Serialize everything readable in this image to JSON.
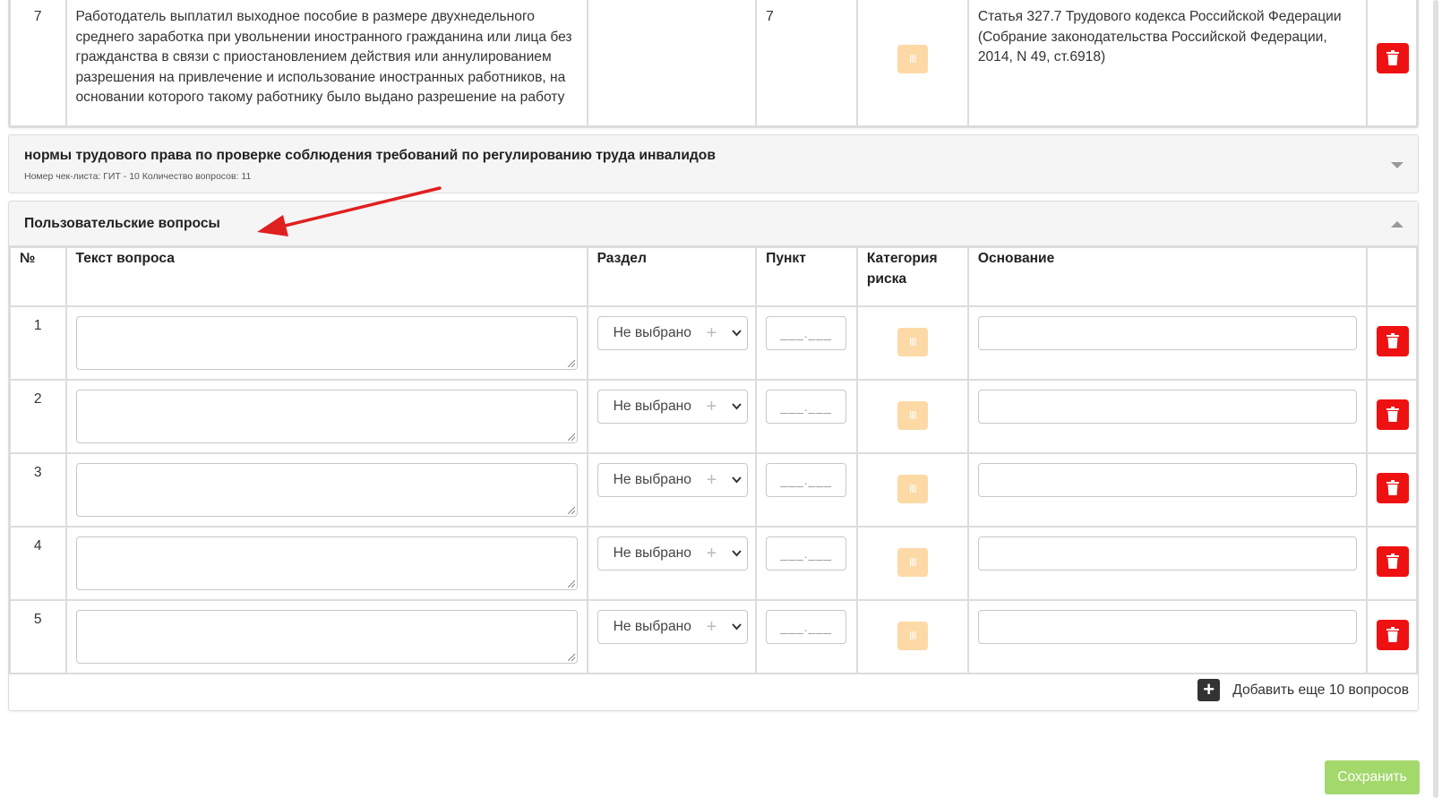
{
  "top_row": {
    "num": "7",
    "text": "Работодатель выплатил выходное пособие в размере двухнедельного среднего заработка при увольнении иностранного гражданина или лица без гражданства в связи с приостановлением действия или аннулированием разрешения на привлечение и использование иностранных работников, на основании которого такому работнику было выдано разрешение на работу",
    "section": "",
    "point": "7",
    "risk_label": "III",
    "basis": "Статья 327.7 Трудового кодекса Российской Федерации (Собрание законодательства Российской Федерации, 2014, N 49, ст.6918)"
  },
  "collapsed_section": {
    "title": "нормы трудового права по проверке соблюдения требований по регулированию труда инвалидов",
    "subtitle": "Номер чек-листа: ГИТ - 10 Количество вопросов: 11"
  },
  "custom_section": {
    "title": "Пользовательские вопросы",
    "columns": {
      "num": "№",
      "text": "Текст вопроса",
      "section": "Раздел",
      "point": "Пункт",
      "risk": "Категория риска",
      "basis": "Основание"
    },
    "rows": [
      {
        "num": "1",
        "section": "Не выбрано",
        "point_mask": "___.___",
        "risk": "III"
      },
      {
        "num": "2",
        "section": "Не выбрано",
        "point_mask": "___.___",
        "risk": "III"
      },
      {
        "num": "3",
        "section": "Не выбрано",
        "point_mask": "___.___",
        "risk": "III"
      },
      {
        "num": "4",
        "section": "Не выбрано",
        "point_mask": "___.___",
        "risk": "III"
      },
      {
        "num": "5",
        "section": "Не выбрано",
        "point_mask": "___.___",
        "risk": "III"
      }
    ],
    "add_label": "Добавить еще 10 вопросов"
  },
  "save_label": "Сохранить",
  "colors": {
    "delete": "#ee1111",
    "risk_badge": "#fdd9a6",
    "save": "#a3d86c",
    "annotation_arrow": "#e02020"
  }
}
